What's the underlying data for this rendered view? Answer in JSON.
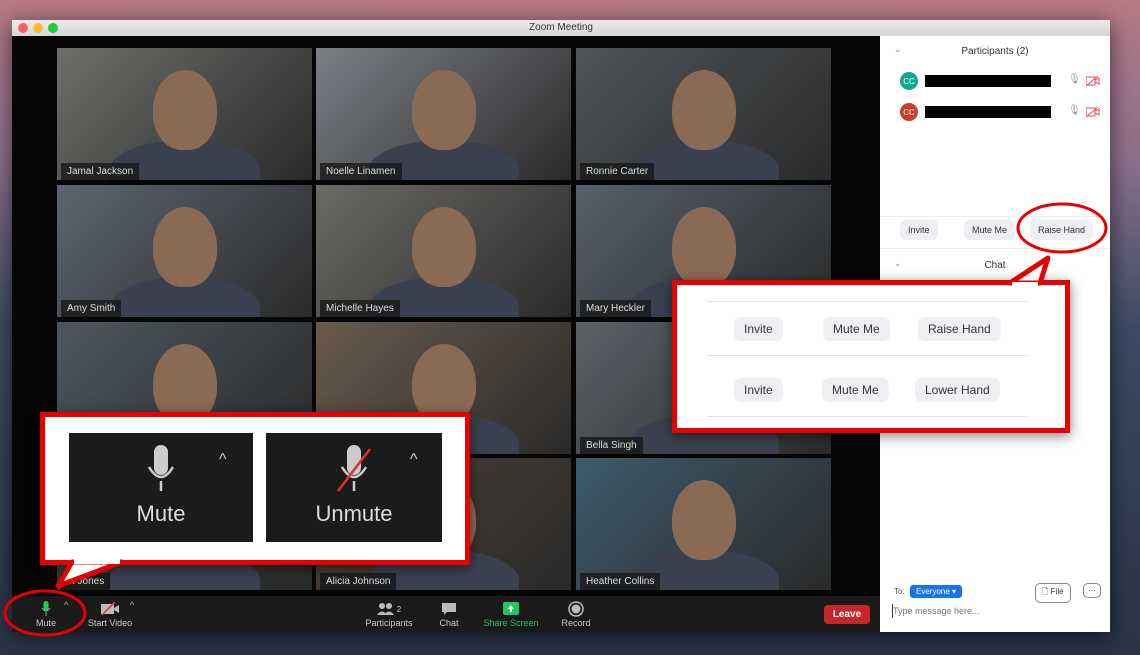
{
  "window": {
    "title": "Zoom Meeting"
  },
  "tiles": [
    {
      "name": "Jamal Jackson",
      "bg": "#6c6f6a"
    },
    {
      "name": "Noelle Linamen",
      "bg": "#7b7f86"
    },
    {
      "name": "Ronnie Carter",
      "bg": "#4f5458"
    },
    {
      "name": "Amy Smith",
      "bg": "#5d6570"
    },
    {
      "name": "Michelle Hayes",
      "bg": "#6c6a66"
    },
    {
      "name": "Mary Heckler",
      "bg": "#55606a"
    },
    {
      "name": "",
      "bg": "#4d5660"
    },
    {
      "name": "",
      "bg": "#6a5a4c"
    },
    {
      "name": "Bella Singh",
      "bg": "#5b6168"
    },
    {
      "name": "el Jones",
      "bg": "#3c3f44"
    },
    {
      "name": "Alicia Johnson",
      "bg": "#4e4238"
    },
    {
      "name": "Heather Collins",
      "bg": "#3d5a6c"
    }
  ],
  "toolbar": {
    "mute": "Mute",
    "start_video": "Start Video",
    "participants": "Participants",
    "participants_count": "2",
    "chat": "Chat",
    "share_screen": "Share Screen",
    "record": "Record",
    "leave": "Leave"
  },
  "sidebar": {
    "participants_title": "Participants (2)",
    "participants": [
      {
        "initials": "CC",
        "color": "#12a88a"
      },
      {
        "initials": "CC",
        "color": "#c8402c"
      }
    ],
    "buttons": {
      "invite": "Invite",
      "mute_me": "Mute Me",
      "raise_hand": "Raise Hand"
    },
    "chat_title": "Chat",
    "to_label": "To:",
    "to_value": "Everyone",
    "file": "File",
    "more": "···",
    "message_placeholder": "Type message here..."
  },
  "callout_audio": {
    "mute": "Mute",
    "unmute": "Unmute"
  },
  "callout_buttons": {
    "row1": [
      "Invite",
      "Mute Me",
      "Raise Hand"
    ],
    "row2": [
      "Invite",
      "Mute Me",
      "Lower Hand"
    ]
  },
  "colors": {
    "accent_green": "#22c55e",
    "leave_red": "#c8242b",
    "callout_red": "#e60000",
    "chip_blue": "#1a73e8"
  }
}
